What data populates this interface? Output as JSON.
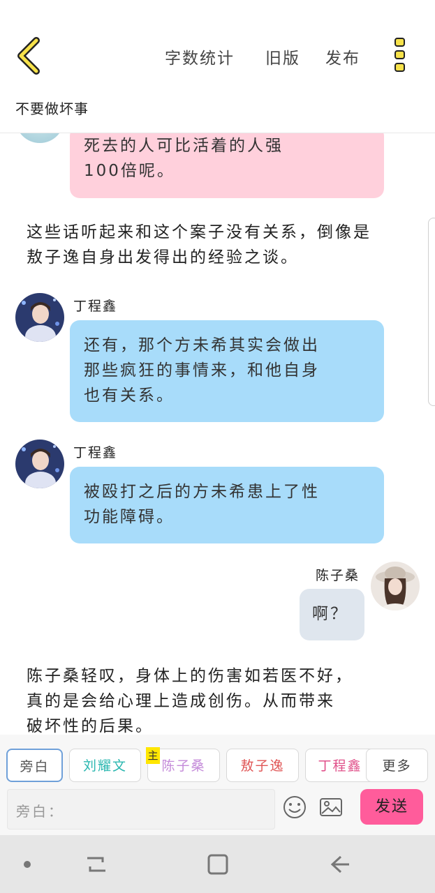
{
  "header": {
    "word_count_label": "字数统计",
    "old_version_label": "旧版",
    "publish_label": "发布"
  },
  "story_title": "不要做坏事",
  "messages": {
    "m1_line1": "死去的人可比活着的人强",
    "m1_line2": "100倍呢。",
    "narration1_line1": "这些话听起来和这个案子没有关系，倒像是",
    "narration1_line2": "敖子逸自身出发得出的经验之谈。",
    "m2_name": "丁程鑫",
    "m2_line1": "还有，那个方未希其实会做出",
    "m2_line2": "那些疯狂的事情来，和他自身",
    "m2_line3": "也有关系。",
    "m3_name": "丁程鑫",
    "m3_line1": "被殴打之后的方未希患上了性",
    "m3_line2": "功能障碍。",
    "m4_name": "陈子桑",
    "m4_text": "啊？",
    "narration2_line1": "陈子桑轻叹，身体上的伤害如若医不好，",
    "narration2_line2": "真的是会给心理上造成创伤。从而带来",
    "narration2_line3": "破坏性的后果。"
  },
  "characters": {
    "c1": "旁白",
    "c2": "刘耀文",
    "c3": "陈子桑",
    "c3_tag": "主",
    "c4": "敖子逸",
    "c5": "丁程鑫",
    "more": "更多"
  },
  "input": {
    "placeholder": "旁白："
  },
  "send_label": "发送",
  "colors": {
    "pink_bubble": "#ffd0dc",
    "blue_bubble": "#a8dcfa",
    "gray_bubble": "#dfe6ee",
    "send_button": "#ff5c9b",
    "accent_yellow": "#ffe600"
  }
}
